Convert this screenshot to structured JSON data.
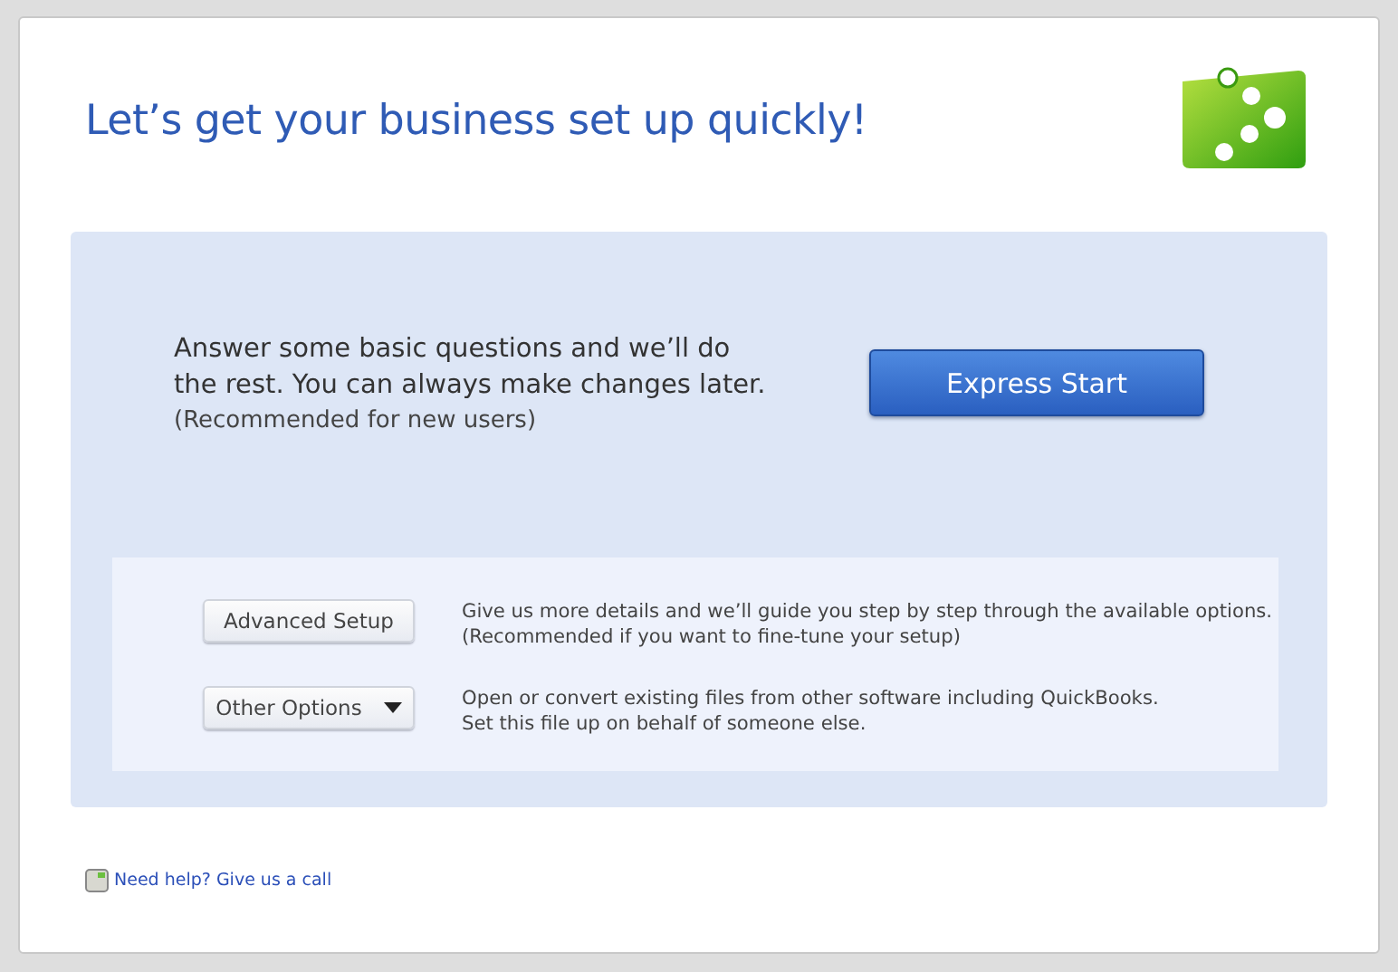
{
  "title": "Let’s get your business set up quickly!",
  "express": {
    "lines": [
      "Answer some basic questions and we’ll do",
      "the rest. You can always make changes later."
    ],
    "note": "(Recommended for new users)",
    "button": "Express Start"
  },
  "options": [
    {
      "kind": "button",
      "label": "Advanced Setup",
      "lines": [
        "Give us more details and we’ll guide you step by step through the available options.",
        "(Recommended if you want to fine-tune your setup)"
      ]
    },
    {
      "kind": "dropdown",
      "label": "Other Options",
      "lines": [
        "Open or convert existing files from other software including QuickBooks.",
        "Set this file up on behalf of someone else."
      ]
    }
  ],
  "help_link": "Need help? Give us a call"
}
